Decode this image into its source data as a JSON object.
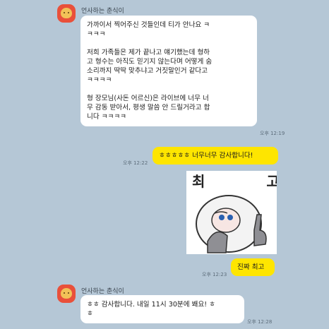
{
  "chat": {
    "sender_name": "언사하는 춘식이",
    "messages": {
      "m1": {
        "paragraphs": [
          "가까이서 찍어주신 것들인데 티가 안나요 ㅋ\nㅋㅋㅋ",
          "저희 가족들은 제가 끝나고 얘기했는데 형하\n고 형수는 아직도 믿기지 않는다며 어떻게 숨\n소리까지 딱딱 맞추냐고 거짓말인거 같다고\nㅋㅋㅋㅋ",
          "형 장모님(사돈 어르신)은 라이브에 너무 너\n무 감동 받아서, 평생 말씀 안 드릴거라고 합\n니다 ㅋㅋㅋㅋ"
        ],
        "time": "오후 12:19"
      },
      "m2": {
        "text": "ㅎㅎㅎㅎㅎ 너무너무 감사합니다!",
        "time": "오후 12:22"
      },
      "sticker": {
        "caption": "최 고",
        "icon": "monkey-sticker-icon"
      },
      "m3": {
        "text": "진짜 최고",
        "time": "오후 12:23"
      },
      "m4": {
        "text": "ㅎㅎ 감사합니다. 내일 11시 30분에 봬요! ㅎ\nㅎ",
        "time": "오후 12:28"
      }
    }
  },
  "colors": {
    "background": "#b5c7d6",
    "my_bubble": "#fee500",
    "their_bubble": "#ffffff",
    "avatar": "#e9503a"
  }
}
